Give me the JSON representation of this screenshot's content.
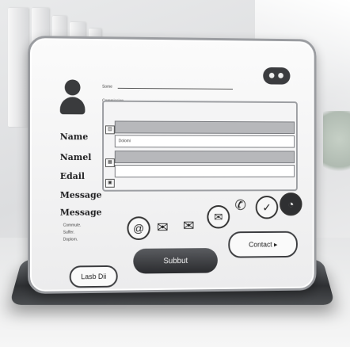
{
  "top_labels": [
    "Some",
    "Commission"
  ],
  "field_hints": [
    "Dolomi"
  ],
  "form_labels": [
    "Name",
    "Namel",
    "Edail",
    "Message",
    "Message"
  ],
  "small_notes": [
    "Commute.",
    "Suffer.",
    "Doplom."
  ],
  "buttons": {
    "left_label": "Lasb Dii",
    "submit_label": "Subbut",
    "contact_label": "Contact ▸"
  },
  "icons": [
    "at-sign-icon",
    "envelope-icon",
    "open-envelope-icon",
    "mail-circle-icon",
    "phone-icon",
    "person-check-icon",
    "wifi-icon"
  ],
  "colors": {
    "frame": "#9a9ca0",
    "dark_button": "#2a2b2e",
    "screen": "#f4f4f5"
  }
}
